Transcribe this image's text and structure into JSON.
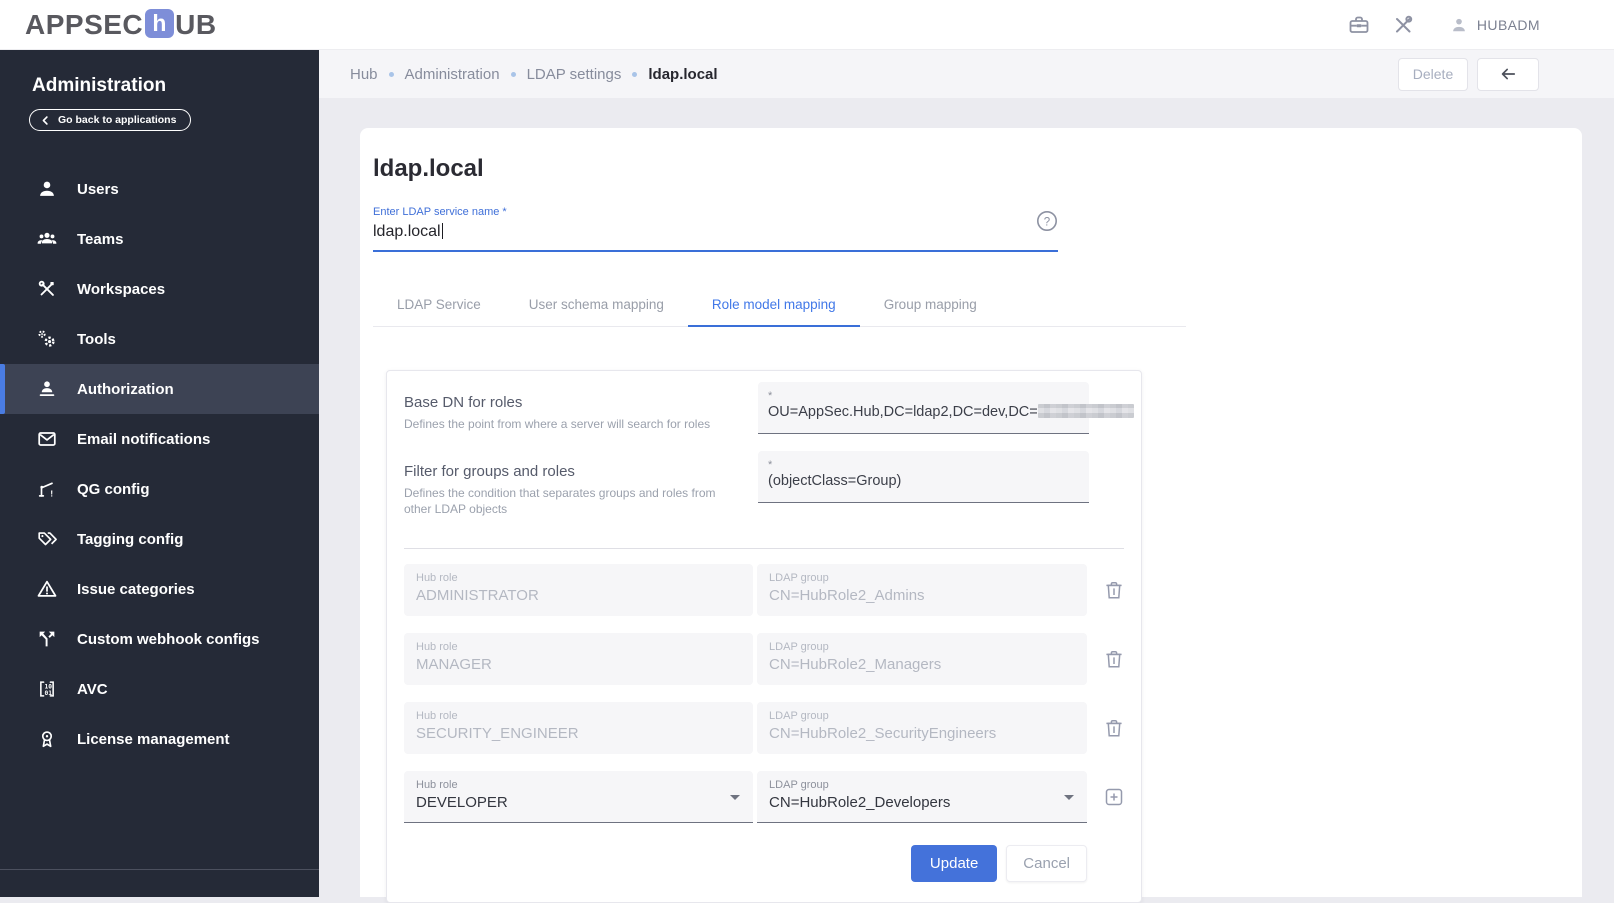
{
  "header": {
    "logo": {
      "part1": "APPSEC",
      "icon_letter": "h",
      "part2": "UB"
    },
    "user": {
      "name": "HUBADM"
    }
  },
  "sidebar": {
    "title": "Administration",
    "back_button": "Go back to applications",
    "items": [
      {
        "label": "Users",
        "icon": "person-icon",
        "selected": false
      },
      {
        "label": "Teams",
        "icon": "group-icon",
        "selected": false
      },
      {
        "label": "Workspaces",
        "icon": "hammer-wrench-icon",
        "selected": false
      },
      {
        "label": "Tools",
        "icon": "gears-icon",
        "selected": false
      },
      {
        "label": "Authorization",
        "icon": "person-authorization-icon",
        "selected": true
      },
      {
        "label": "Email notifications",
        "icon": "envelope-icon",
        "selected": false
      },
      {
        "label": "QG config",
        "icon": "quality-gate-icon",
        "selected": false
      },
      {
        "label": "Tagging config",
        "icon": "tag-icon",
        "selected": false
      },
      {
        "label": "Issue categories",
        "icon": "warning-triangle-icon",
        "selected": false
      },
      {
        "label": "Custom webhook configs",
        "icon": "split-arrows-icon",
        "selected": false
      },
      {
        "label": "AVC",
        "icon": "binary-brackets-icon",
        "selected": false
      },
      {
        "label": "License management",
        "icon": "award-icon",
        "selected": false
      }
    ]
  },
  "breadcrumb": {
    "items": [
      "Hub",
      "Administration",
      "LDAP settings",
      "ldap.local"
    ]
  },
  "toolbar": {
    "delete_label": "Delete",
    "back_icon": "left-arrow"
  },
  "main": {
    "title": "ldap.local",
    "service_name_field": {
      "label": "Enter LDAP service name *",
      "value": "ldap.local"
    },
    "tabs": [
      {
        "label": "LDAP Service",
        "active": false
      },
      {
        "label": "User schema mapping",
        "active": false
      },
      {
        "label": "Role model mapping",
        "active": true
      },
      {
        "label": "Group mapping",
        "active": false
      }
    ],
    "card": {
      "fields": [
        {
          "name": "Base DN for roles",
          "description": "Defines the point from where a server will search for roles",
          "required_marker": "*",
          "value": "OU=AppSec.Hub,DC=ldap2,DC=dev,DC=",
          "value_redacted_suffix": true
        },
        {
          "name": "Filter for groups and roles",
          "description": "Defines the condition that separates groups and roles from other LDAP objects",
          "required_marker": "*",
          "value": "(objectClass=Group)",
          "value_redacted_suffix": false
        }
      ],
      "role_mappings": {
        "hub_role_label": "Hub role",
        "ldap_group_label": "LDAP group",
        "rows": [
          {
            "hub_role": "ADMINISTRATOR",
            "ldap_group": "CN=HubRole2_Admins",
            "editable": false
          },
          {
            "hub_role": "MANAGER",
            "ldap_group": "CN=HubRole2_Managers",
            "editable": false
          },
          {
            "hub_role": "SECURITY_ENGINEER",
            "ldap_group": "CN=HubRole2_SecurityEngineers",
            "editable": false
          },
          {
            "hub_role": "DEVELOPER",
            "ldap_group": "CN=HubRole2_Developers",
            "editable": true
          }
        ]
      },
      "actions": {
        "update_label": "Update",
        "cancel_label": "Cancel"
      }
    }
  },
  "colors": {
    "accent_blue": "#4472da",
    "tab_active_blue": "#4178e8",
    "sidebar_bg": "#252a37",
    "selected_item_bg": "#3d4354",
    "selected_item_bar": "#4a7ce2",
    "breadcrumb_dot": "#a9c4e8",
    "page_bg": "#ebebf0"
  }
}
